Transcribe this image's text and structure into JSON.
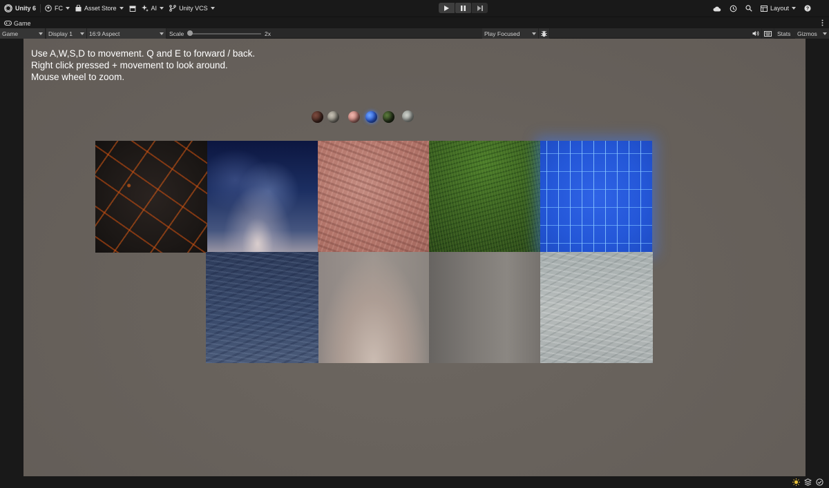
{
  "toolbar": {
    "app_title": "Unity 6",
    "account": "FC",
    "asset_store": "Asset Store",
    "ai": "AI",
    "vcs": "Unity VCS",
    "layout": "Layout"
  },
  "tabs": [
    {
      "label": "Game"
    }
  ],
  "gamebar": {
    "mode": "Game",
    "display": "Display 1",
    "aspect": "16:9 Aspect",
    "scale_label": "Scale",
    "scale_value": "2x",
    "play_mode": "Play Focused",
    "stats": "Stats",
    "gizmos": "Gizmos"
  },
  "game_view": {
    "instructions": [
      "Use A,W,S,D to movement. Q and E to forward / back.",
      "Right click pressed + movement to look around.",
      "Mouse wheel to zoom."
    ]
  },
  "colors": {
    "editor_bg": "#191919",
    "viewport_bg": "#68625c",
    "circuit_glow": "#2f63e6"
  }
}
